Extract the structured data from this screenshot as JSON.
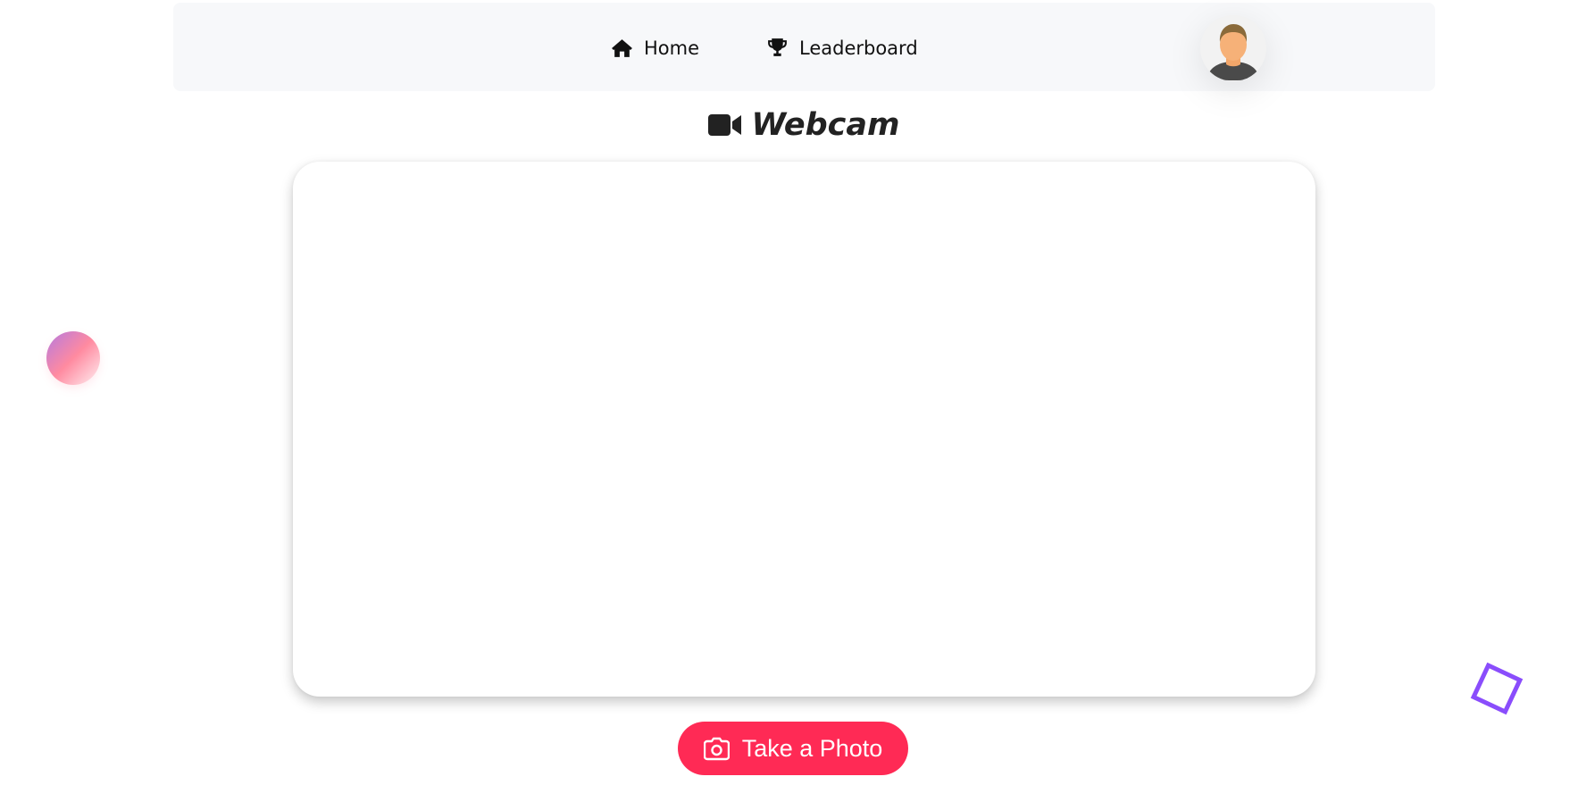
{
  "nav": {
    "home_label": "Home",
    "home_icon": "home-icon",
    "leaderboard_label": "Leaderboard",
    "leaderboard_icon": "trophy-icon",
    "avatar_icon": "user-avatar-icon"
  },
  "page": {
    "title": "Webcam",
    "title_icon": "video-camera-icon"
  },
  "actions": {
    "take_photo_label": "Take a Photo",
    "take_photo_icon": "camera-icon"
  },
  "colors": {
    "accent": "#ff2a55",
    "decor_purple": "#8a4dfc",
    "navbar_bg": "#f7f8fa"
  }
}
